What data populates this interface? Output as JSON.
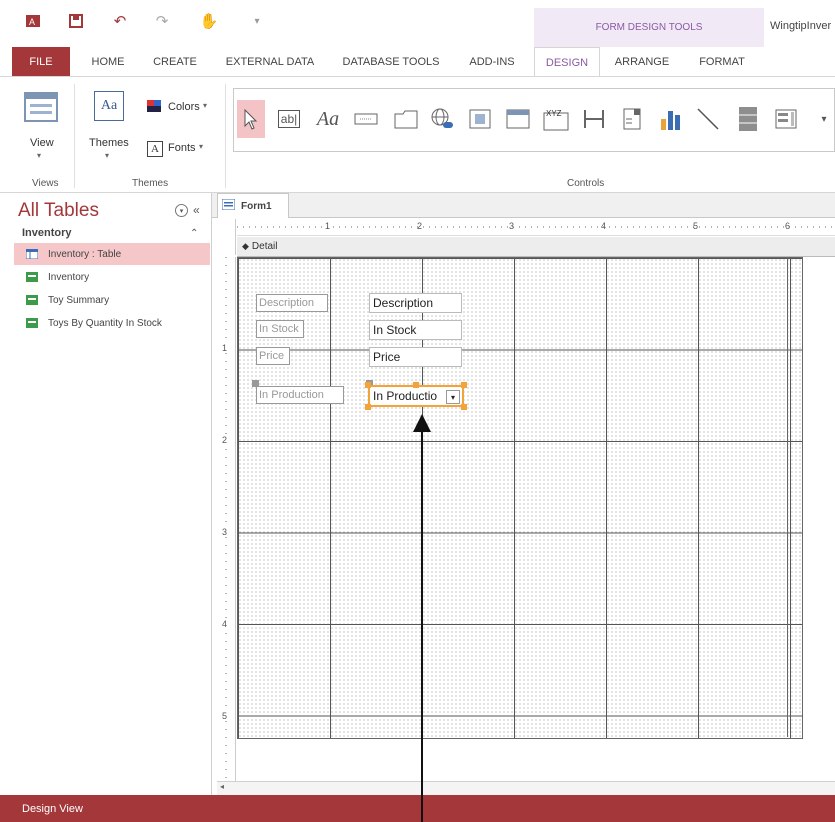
{
  "window": {
    "title": "WingtipInver",
    "context_tab_group": "FORM DESIGN TOOLS"
  },
  "tabs": [
    "FILE",
    "HOME",
    "CREATE",
    "EXTERNAL DATA",
    "DATABASE TOOLS",
    "ADD-INS",
    "DESIGN",
    "ARRANGE",
    "FORMAT"
  ],
  "ribbon": {
    "views": {
      "button": "View",
      "group": "Views"
    },
    "themes": {
      "button": "Themes",
      "colors": "Colors",
      "fonts": "Fonts",
      "group": "Themes"
    },
    "controls": {
      "group": "Controls",
      "label_glyph": "Aa",
      "textbox_glyph": "ab|",
      "xyz": "XYZ"
    }
  },
  "nav": {
    "title": "All Tables",
    "group": "Inventory",
    "items": [
      "Inventory : Table",
      "Inventory",
      "Toy Summary",
      "Toys By Quantity In Stock"
    ]
  },
  "document": {
    "tab": "Form1",
    "section": "Detail",
    "ruler_h": [
      "1",
      "2",
      "3",
      "4",
      "5",
      "6"
    ],
    "ruler_v": [
      "1",
      "2",
      "3",
      "4",
      "5"
    ]
  },
  "form": {
    "labels": [
      "Description",
      "In Stock",
      "Price",
      "In Production"
    ],
    "fields": [
      "Description",
      "In Stock",
      "Price",
      "In Productio"
    ]
  },
  "status": {
    "text": "Design View"
  },
  "colors": {
    "accent": "#a4373a",
    "design_tab": "#8a5aa3",
    "selection": "#f2a33a"
  }
}
